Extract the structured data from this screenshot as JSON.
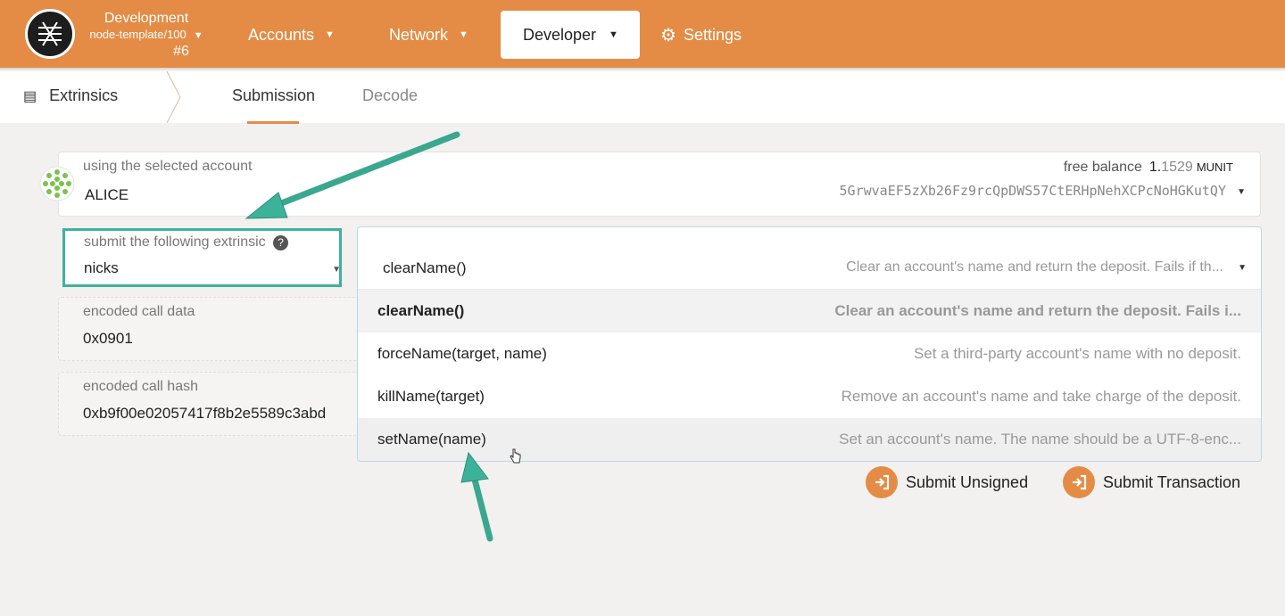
{
  "header": {
    "chain_name": "Development",
    "chain_runtime": "node-template/100",
    "block_number": "#6",
    "nav": {
      "accounts": "Accounts",
      "network": "Network",
      "developer": "Developer",
      "settings": "Settings"
    }
  },
  "subnav": {
    "section": "Extrinsics",
    "tabs": [
      {
        "label": "Submission",
        "active": true
      },
      {
        "label": "Decode",
        "active": false
      }
    ]
  },
  "account": {
    "label": "using the selected account",
    "name": "ALICE",
    "free_balance_label": "free balance",
    "balance_int": "1.",
    "balance_dec": "1529",
    "balance_unit": "MUNIT",
    "address": "5GrwvaEF5zXb26Fz9rcQpDWS57CtERHpNehXCPcNoHGKutQY"
  },
  "extrinsic": {
    "label": "submit the following extrinsic",
    "help": "?",
    "pallet": "nicks"
  },
  "call_data": {
    "label": "encoded call data",
    "value": "0x0901"
  },
  "call_hash": {
    "label": "encoded call hash",
    "value": "0xb9f00e02057417f8b2e5589c3abd"
  },
  "dropdown": {
    "selected": {
      "name": "clearName()",
      "desc": "Clear an account's name and return the deposit. Fails if th..."
    },
    "options": [
      {
        "name": "clearName()",
        "desc": "Clear an account's name and return the deposit. Fails i..."
      },
      {
        "name": "forceName(target, name)",
        "desc": "Set a third-party account's name with no deposit."
      },
      {
        "name": "killName(target)",
        "desc": "Remove an account's name and take charge of the deposit."
      },
      {
        "name": "setName(name)",
        "desc": "Set an account's name. The name should be a UTF-8-enc..."
      }
    ]
  },
  "buttons": {
    "submit_unsigned": "Submit Unsigned",
    "submit_transaction": "Submit Transaction"
  },
  "colors": {
    "brand": "#e48c45",
    "annotation": "#3db29a"
  },
  "icons": {
    "logo": "substrate-logo",
    "extrinsics": "extrinsics-icon",
    "settings": "gear-icon",
    "submit": "sign-in-icon"
  }
}
